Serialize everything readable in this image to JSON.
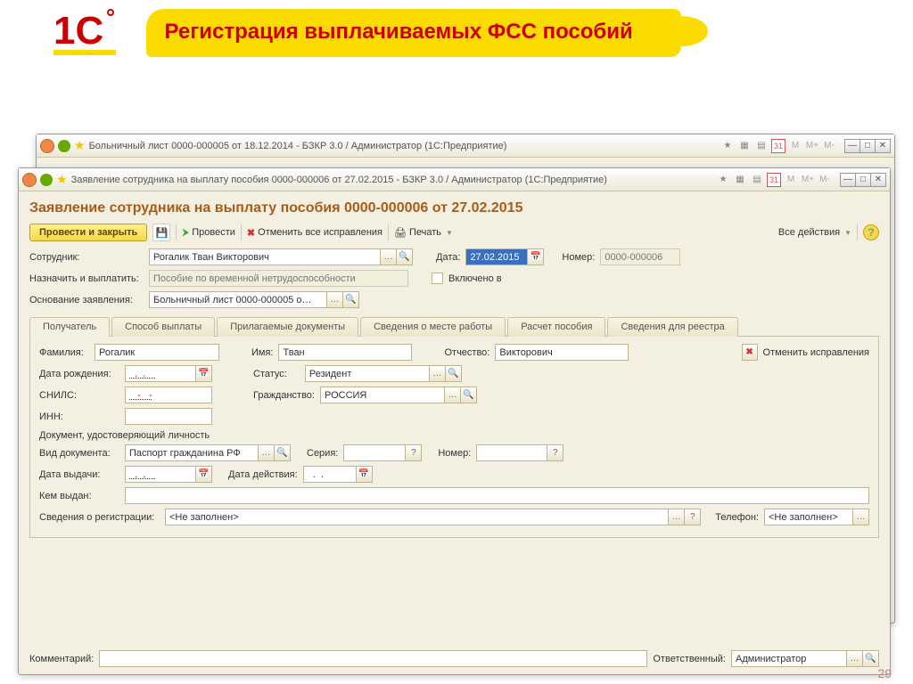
{
  "slide": {
    "title": "Регистрация выплачиваемых ФСС пособий",
    "page": "29"
  },
  "back_window": {
    "title": "Больничный лист 0000-000005 от 18.12.2014 - БЗКР 3.0 / Администратор  (1С:Предприятие)"
  },
  "front_window": {
    "title": "Заявление сотрудника на выплату пособия 0000-000006 от 27.02.2015 - БЗКР 3.0 / Администратор  (1С:Предприятие)",
    "doc_title": "Заявление сотрудника на выплату пособия 0000-000006 от 27.02.2015"
  },
  "mem_icons": {
    "m1": "M",
    "m2": "M+",
    "m3": "M-"
  },
  "toolbar": {
    "submit_close": "Провести и закрыть",
    "submit": "Провести",
    "cancel_all": "Отменить все исправления",
    "print": "Печать",
    "all_actions": "Все действия"
  },
  "header": {
    "employee_lbl": "Сотрудник:",
    "employee_val": "Рогалик Тван Викторович",
    "date_lbl": "Дата:",
    "date_val": "27.02.2015",
    "number_lbl": "Номер:",
    "number_val": "0000-000006",
    "assign_lbl": "Назначить и выплатить:",
    "assign_val": "Пособие по временной нетрудоспособности",
    "included_lbl": "Включено в",
    "basis_lbl": "Основание заявления:",
    "basis_val": "Больничный лист 0000-000005 о…"
  },
  "tabs": {
    "t1": "Получатель",
    "t2": "Способ выплаты",
    "t3": "Прилагаемые документы",
    "t4": "Сведения о месте работы",
    "t5": "Расчет пособия",
    "t6": "Сведения для реестра"
  },
  "recipient": {
    "surname_lbl": "Фамилия:",
    "surname": "Рогалик",
    "name_lbl": "Имя:",
    "name": "Тван",
    "patronymic_lbl": "Отчество:",
    "patronymic": "Викторович",
    "cancel_fix": "Отменить исправления",
    "dob_lbl": "Дата рождения:",
    "dob": "  .  .    ",
    "status_lbl": "Статус:",
    "status": "Резидент",
    "snils_lbl": "СНИЛС:",
    "snils": "   -   -",
    "citizen_lbl": "Гражданство:",
    "citizen": "РОССИЯ",
    "inn_lbl": "ИНН:",
    "inn": "",
    "id_section": "Документ, удостоверяющий личность",
    "doctype_lbl": "Вид документа:",
    "doctype": "Паспорт гражданина РФ",
    "series_lbl": "Серия:",
    "series": "",
    "nomer_lbl": "Номер:",
    "nomer": "",
    "issue_date_lbl": "Дата выдачи:",
    "issue_date": "  .  .    ",
    "valid_date_lbl": "Дата действия:",
    "valid_date": "  .  .",
    "issued_by_lbl": "Кем выдан:",
    "issued_by": "",
    "reg_lbl": "Сведения о регистрации:",
    "reg": "<Не заполнен>",
    "phone_lbl": "Телефон:",
    "phone": "<Не заполнен>"
  },
  "footer": {
    "comment_lbl": "Комментарий:",
    "comment": "",
    "resp_lbl": "Ответственный:",
    "resp": "Администратор"
  }
}
